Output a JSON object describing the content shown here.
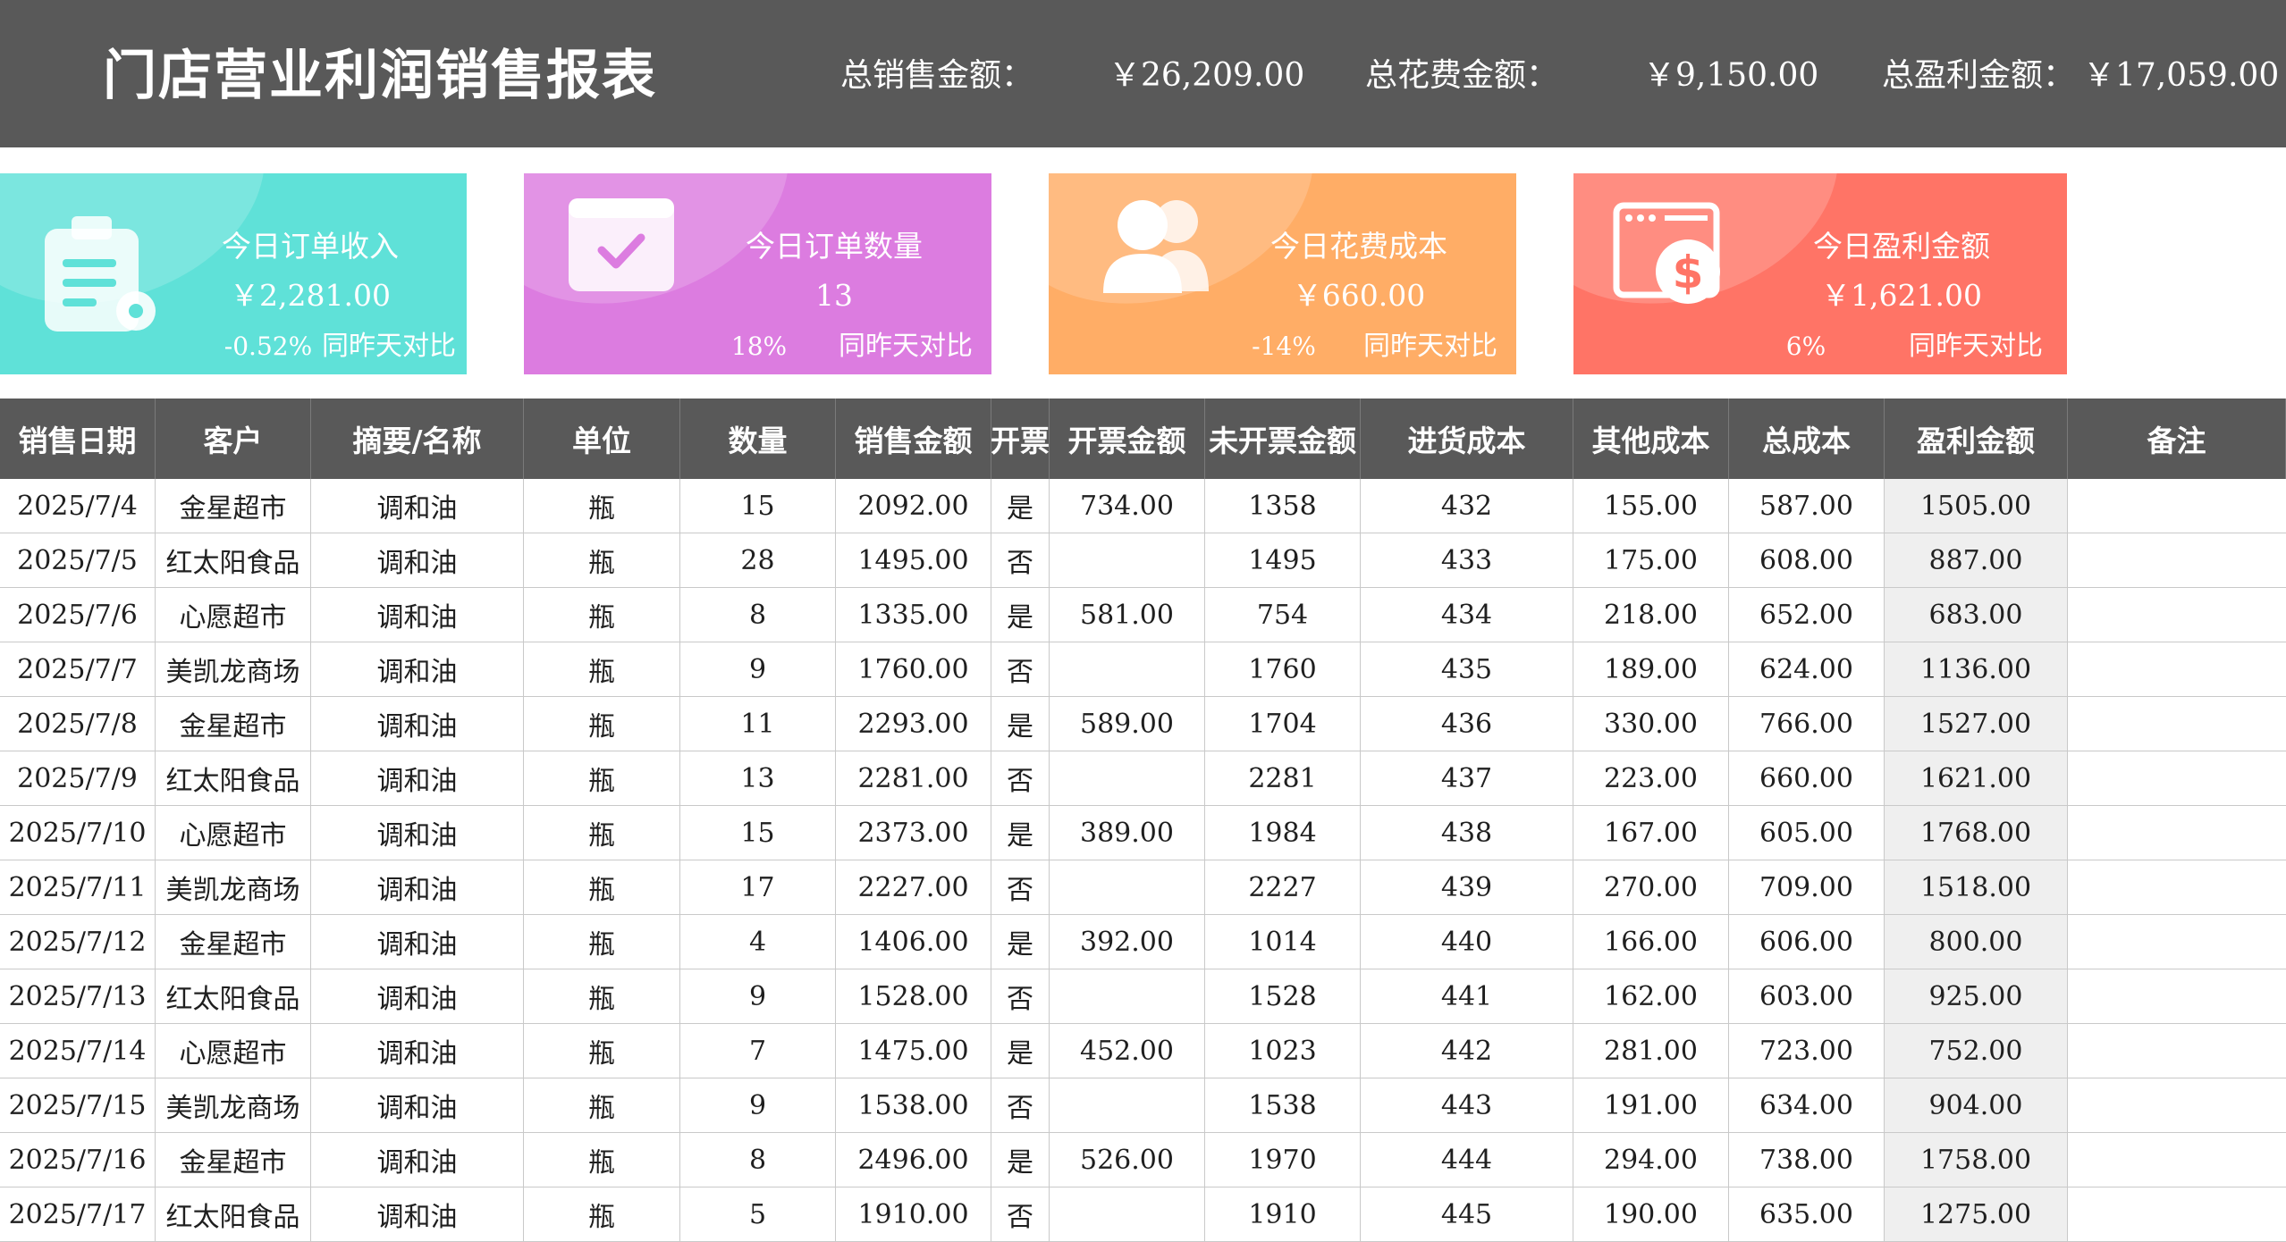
{
  "header": {
    "title": "门店营业利润销售报表",
    "total_sales_label": "总销售金额：",
    "total_sales_value": "￥26,209.00",
    "total_cost_label": "总花费金额：",
    "total_cost_value": "￥9,150.00",
    "total_profit_label": "总盈利金额：",
    "total_profit_value": "￥17,059.00"
  },
  "cards": [
    {
      "label": "今日订单收入",
      "value": "￥2,281.00",
      "pct": "-0.52%",
      "compare": "同昨天对比",
      "color": "#5fe1d8",
      "icon": "clipboard-icon"
    },
    {
      "label": "今日订单数量",
      "value": "13",
      "pct": "18%",
      "compare": "同昨天对比",
      "color": "#dc7ce0",
      "icon": "calendar-check-icon"
    },
    {
      "label": "今日花费成本",
      "value": "￥660.00",
      "pct": "-14%",
      "compare": "同昨天对比",
      "color": "#ffad66",
      "icon": "users-icon"
    },
    {
      "label": "今日盈利金额",
      "value": "￥1,621.00",
      "pct": "6%",
      "compare": "同昨天对比",
      "color": "#ff7466",
      "icon": "dollar-window-icon"
    }
  ],
  "table": {
    "headers": [
      "销售日期",
      "客户",
      "摘要/名称",
      "单位",
      "数量",
      "销售金额",
      "开票",
      "开票金额",
      "未开票金额",
      "进货成本",
      "其他成本",
      "总成本",
      "盈利金额",
      "备注"
    ],
    "rows": [
      [
        "2025/7/4",
        "金星超市",
        "调和油",
        "瓶",
        "15",
        "2092.00",
        "是",
        "734.00",
        "1358",
        "432",
        "155.00",
        "587.00",
        "1505.00",
        ""
      ],
      [
        "2025/7/5",
        "红太阳食品",
        "调和油",
        "瓶",
        "28",
        "1495.00",
        "否",
        "",
        "1495",
        "433",
        "175.00",
        "608.00",
        "887.00",
        ""
      ],
      [
        "2025/7/6",
        "心愿超市",
        "调和油",
        "瓶",
        "8",
        "1335.00",
        "是",
        "581.00",
        "754",
        "434",
        "218.00",
        "652.00",
        "683.00",
        ""
      ],
      [
        "2025/7/7",
        "美凯龙商场",
        "调和油",
        "瓶",
        "9",
        "1760.00",
        "否",
        "",
        "1760",
        "435",
        "189.00",
        "624.00",
        "1136.00",
        ""
      ],
      [
        "2025/7/8",
        "金星超市",
        "调和油",
        "瓶",
        "11",
        "2293.00",
        "是",
        "589.00",
        "1704",
        "436",
        "330.00",
        "766.00",
        "1527.00",
        ""
      ],
      [
        "2025/7/9",
        "红太阳食品",
        "调和油",
        "瓶",
        "13",
        "2281.00",
        "否",
        "",
        "2281",
        "437",
        "223.00",
        "660.00",
        "1621.00",
        ""
      ],
      [
        "2025/7/10",
        "心愿超市",
        "调和油",
        "瓶",
        "15",
        "2373.00",
        "是",
        "389.00",
        "1984",
        "438",
        "167.00",
        "605.00",
        "1768.00",
        ""
      ],
      [
        "2025/7/11",
        "美凯龙商场",
        "调和油",
        "瓶",
        "17",
        "2227.00",
        "否",
        "",
        "2227",
        "439",
        "270.00",
        "709.00",
        "1518.00",
        ""
      ],
      [
        "2025/7/12",
        "金星超市",
        "调和油",
        "瓶",
        "4",
        "1406.00",
        "是",
        "392.00",
        "1014",
        "440",
        "166.00",
        "606.00",
        "800.00",
        ""
      ],
      [
        "2025/7/13",
        "红太阳食品",
        "调和油",
        "瓶",
        "9",
        "1528.00",
        "否",
        "",
        "1528",
        "441",
        "162.00",
        "603.00",
        "925.00",
        ""
      ],
      [
        "2025/7/14",
        "心愿超市",
        "调和油",
        "瓶",
        "7",
        "1475.00",
        "是",
        "452.00",
        "1023",
        "442",
        "281.00",
        "723.00",
        "752.00",
        ""
      ],
      [
        "2025/7/15",
        "美凯龙商场",
        "调和油",
        "瓶",
        "9",
        "1538.00",
        "否",
        "",
        "1538",
        "443",
        "191.00",
        "634.00",
        "904.00",
        ""
      ],
      [
        "2025/7/16",
        "金星超市",
        "调和油",
        "瓶",
        "8",
        "2496.00",
        "是",
        "526.00",
        "1970",
        "444",
        "294.00",
        "738.00",
        "1758.00",
        ""
      ],
      [
        "2025/7/17",
        "红太阳食品",
        "调和油",
        "瓶",
        "5",
        "1910.00",
        "否",
        "",
        "1910",
        "445",
        "190.00",
        "635.00",
        "1275.00",
        ""
      ]
    ]
  }
}
